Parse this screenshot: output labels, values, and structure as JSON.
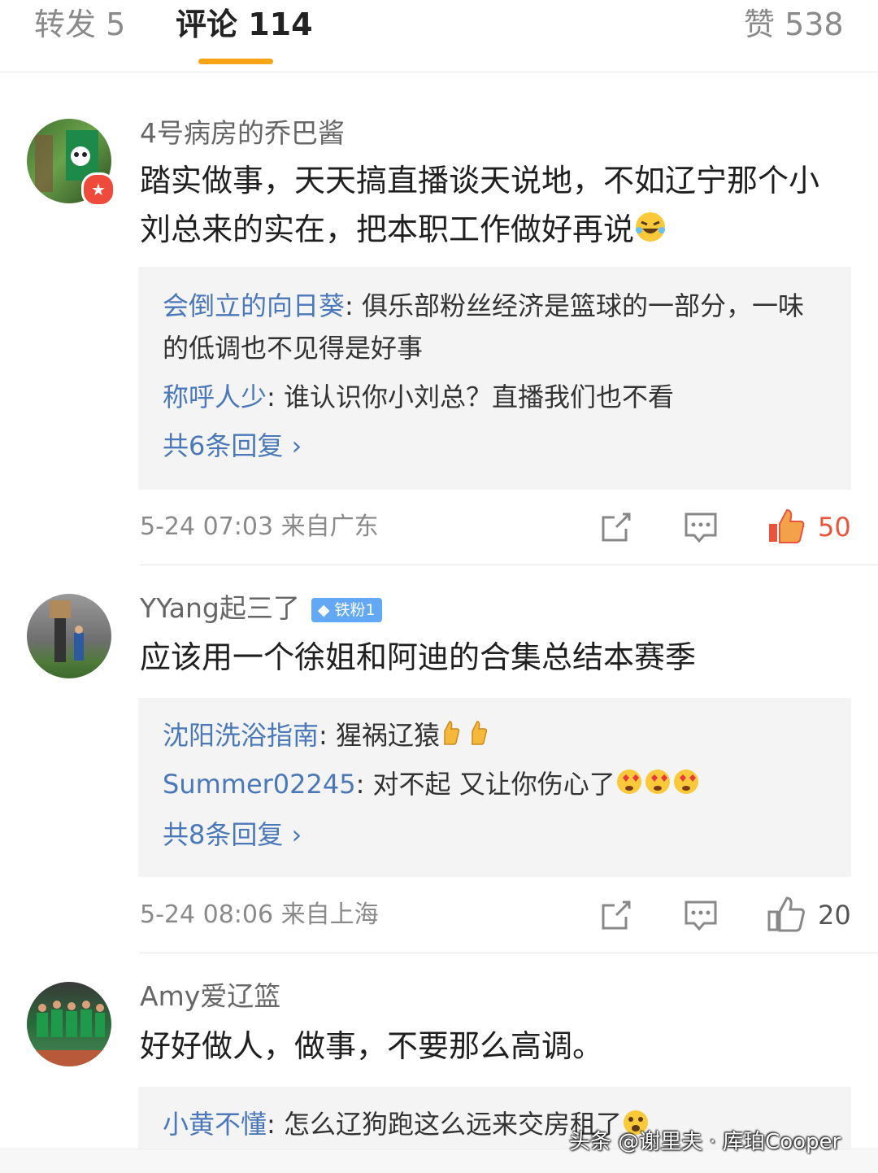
{
  "tabs": {
    "reposts": "转发 5",
    "comments": "评论 114",
    "likes": "赞 538"
  },
  "colors": {
    "accent": "#f7a418",
    "link": "#4a78b8",
    "liked": "#e8543c"
  },
  "comments": [
    {
      "username": "4号病房的乔巴酱",
      "text": "踏实做事，天天搞直播谈天说地，不如辽宁那个小刘总来的实在，把本职工作做好再说",
      "replies": [
        {
          "name": "会倒立的向日葵",
          "text": ": 俱乐部粉丝经济是篮球的一部分，一味的低调也不见得是好事"
        },
        {
          "name": "称呼人少",
          "text": ": 谁认识你小刘总？直播我们也不看"
        }
      ],
      "more": "共6条回复 ›",
      "meta": "5-24 07:03  来自广东",
      "likes": "50"
    },
    {
      "username": "YYang起三了",
      "fan_badge": "铁粉1",
      "text": "应该用一个徐姐和阿迪的合集总结本赛季",
      "replies": [
        {
          "name": "沈阳洗浴指南",
          "text": ": 猩祸辽猿"
        },
        {
          "name": "Summer02245",
          "text": ": 对不起  又让你伤心了"
        }
      ],
      "more": "共8条回复 ›",
      "meta": "5-24 08:06  来自上海",
      "likes": "20"
    },
    {
      "username": "Amy爱辽篮",
      "text": "好好做人，做事，不要那么高调。",
      "replies": [
        {
          "name": "小黄不懂",
          "text": ": 怎么辽狗跑这么远来交房租了"
        }
      ]
    }
  ],
  "watermark": "头条 @谢里夫 · 库珀Cooper"
}
